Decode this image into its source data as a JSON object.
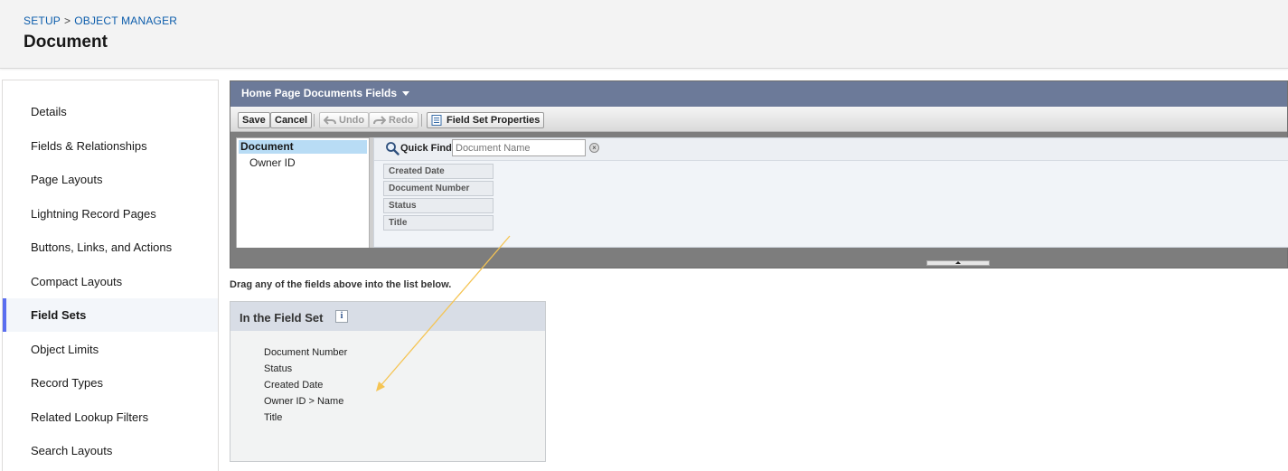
{
  "header": {
    "breadcrumb_setup": "SETUP",
    "breadcrumb_separator": ">",
    "breadcrumb_object_manager": "OBJECT MANAGER",
    "title": "Document"
  },
  "sidebar": {
    "items": [
      {
        "label": "Details",
        "active": false
      },
      {
        "label": "Fields & Relationships",
        "active": false
      },
      {
        "label": "Page Layouts",
        "active": false
      },
      {
        "label": "Lightning Record Pages",
        "active": false
      },
      {
        "label": "Buttons, Links, and Actions",
        "active": false
      },
      {
        "label": "Compact Layouts",
        "active": false
      },
      {
        "label": "Field Sets",
        "active": true
      },
      {
        "label": "Object Limits",
        "active": false
      },
      {
        "label": "Record Types",
        "active": false
      },
      {
        "label": "Related Lookup Filters",
        "active": false
      },
      {
        "label": "Search Layouts",
        "active": false
      }
    ]
  },
  "builder": {
    "title": "Home Page Documents Fields",
    "toolbar": {
      "save": "Save",
      "cancel": "Cancel",
      "undo": "Undo",
      "redo": "Redo",
      "properties": "Field Set Properties"
    },
    "tree": {
      "root": "Document",
      "child": "Owner ID"
    },
    "quick_find": {
      "label": "Quick Find",
      "placeholder": "Document Name",
      "clear_symbol": "×"
    },
    "fields": [
      "Created Date",
      "Document Number",
      "Status",
      "Title"
    ]
  },
  "hint": "Drag any of the fields above into the list below.",
  "field_set": {
    "title": "In the Field Set",
    "info_symbol": "i",
    "items": [
      "Document Number",
      "Status",
      "Created Date",
      "Owner ID > Name",
      "Title"
    ]
  },
  "colors": {
    "accent_link": "#0b5cab",
    "builder_title_bg": "#6c7a99",
    "active_nav_bar": "#5a6ef0",
    "annotation_arrow": "#f5c453"
  }
}
